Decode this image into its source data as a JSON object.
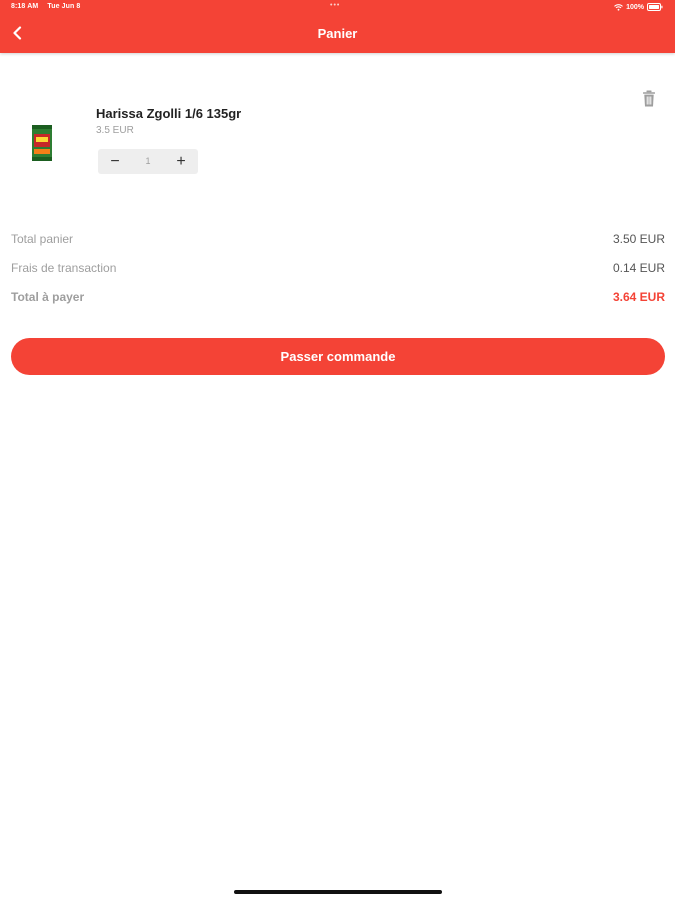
{
  "status_bar": {
    "time": "8:18 AM",
    "date": "Tue Jun 8",
    "dots": "•••",
    "battery": "100%"
  },
  "header": {
    "title": "Panier",
    "back_icon": "chevron-left-icon"
  },
  "cart": {
    "items": [
      {
        "name": "Harissa Zgolli 1/6 135gr",
        "price": "3.5 EUR",
        "quantity": "1",
        "decrement_label": "−",
        "increment_label": "+",
        "delete_icon": "trash-icon"
      }
    ]
  },
  "totals": {
    "subtotal_label": "Total panier",
    "subtotal_value": "3.50 EUR",
    "fees_label": "Frais de transaction",
    "fees_value": "0.14 EUR",
    "total_label": "Total à payer",
    "total_value": "3.64 EUR"
  },
  "actions": {
    "order_label": "Passer commande"
  },
  "colors": {
    "accent": "#f44336",
    "muted_text": "#9e9e9e",
    "stepper_bg": "#eeeeee"
  }
}
